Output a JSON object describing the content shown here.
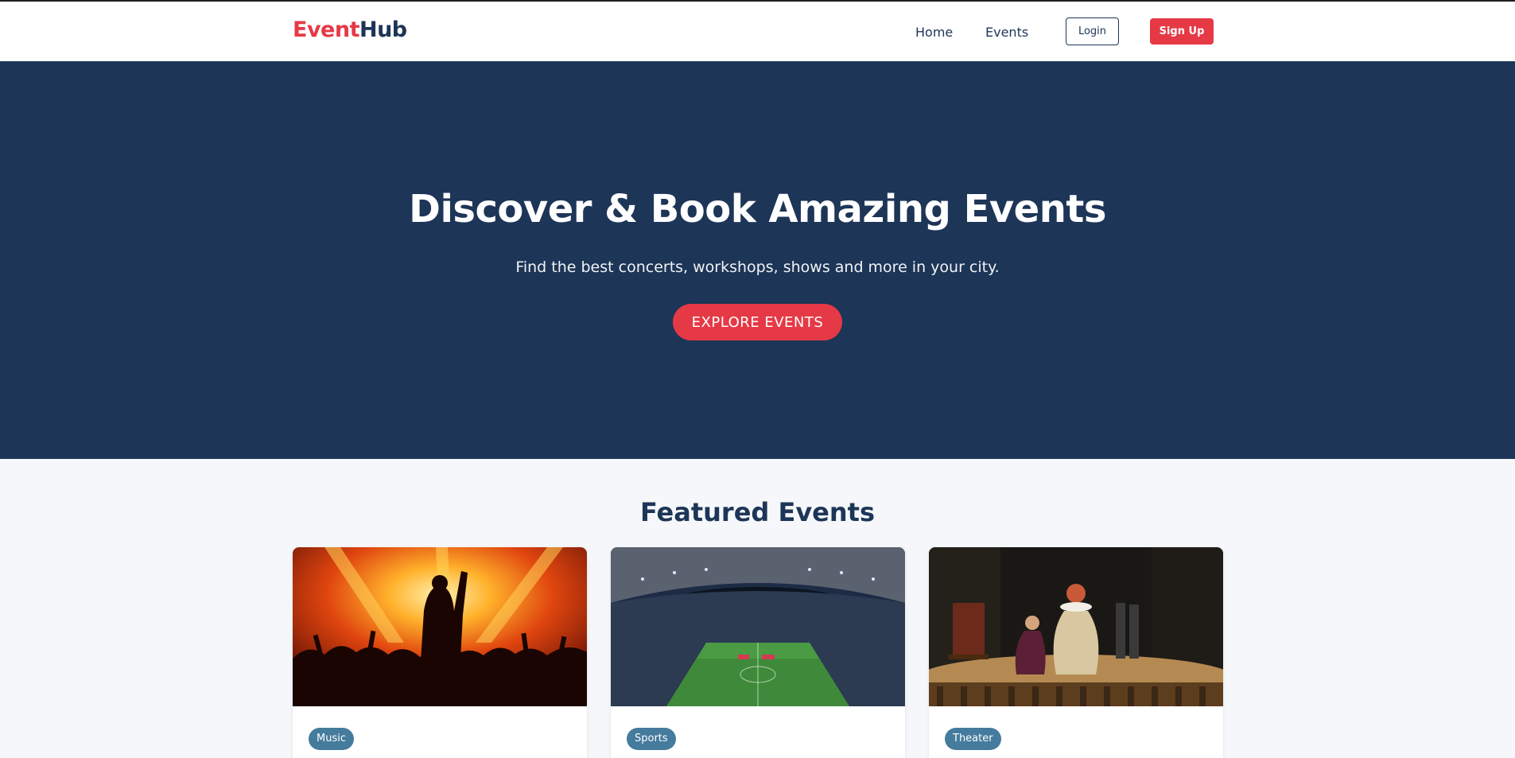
{
  "brand": {
    "part1": "Event",
    "part2": "Hub"
  },
  "nav": {
    "home": "Home",
    "events": "Events",
    "login": "Login",
    "signup": "Sign Up"
  },
  "hero": {
    "title": "Discover & Book Amazing Events",
    "subtitle": "Find the best concerts, workshops, shows and more in your city.",
    "cta": "EXPLORE EVENTS"
  },
  "featured": {
    "title": "Featured Events",
    "cards": [
      {
        "category": "Music",
        "image": "concert-photo"
      },
      {
        "category": "Sports",
        "image": "stadium-photo"
      },
      {
        "category": "Theater",
        "image": "theater-stage-photo"
      }
    ]
  },
  "colors": {
    "accent": "#e63946",
    "navy": "#1d3557",
    "badge": "#457b9d"
  }
}
